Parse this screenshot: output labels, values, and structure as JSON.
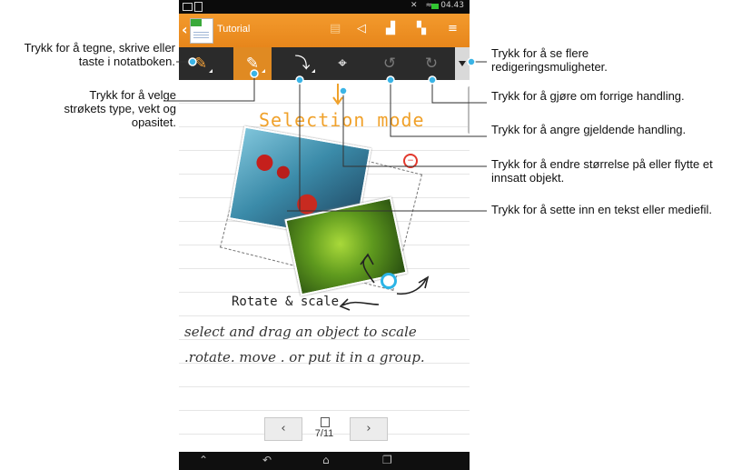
{
  "callouts": {
    "draw_mode": "Trykk for å tegne, skrive eller taste i notatboken.",
    "stroke_settings": "Trykk for å velge strøkets type, vekt og opasitet.",
    "more_options": "Trykk for å se flere redigeringsmuligheter.",
    "redo": "Trykk for å gjøre om forrige handling.",
    "undo": "Trykk for å angre gjeldende handling.",
    "selection": "Trykk for å endre størrelse på eller flytte et innsatt objekt.",
    "insert": "Trykk for å sette inn en tekst eller mediefil."
  },
  "statusbar": {
    "time": "04.43"
  },
  "actionbar": {
    "back": "‹",
    "title": "Tutorial"
  },
  "toolbar": {
    "draw": "✎",
    "pen": "✎",
    "insert": "⤵",
    "selection": "⌖",
    "undo": "↺",
    "redo": "↻"
  },
  "page": {
    "selection_mode": "Selection mode",
    "rotate_scale": "Rotate & scale",
    "hw_line1": "select and drag an object to scale",
    "hw_line2": ".rotate. move . or put it in a group."
  },
  "pager": {
    "prev": "‹",
    "next": "›",
    "count": "7/11"
  },
  "colors": {
    "accent": "#e08a22",
    "toolbar_bg": "#2b2b2b",
    "handwriting_orange": "#f0a12a",
    "cyan_handle": "#2cb4e6"
  },
  "icons": [
    "back-icon",
    "note-icon",
    "share-icon",
    "add-page-icon",
    "delete-page-icon",
    "menu-icon",
    "pen-icon",
    "insert-icon",
    "selection-icon",
    "undo-icon",
    "redo-icon",
    "overflow-icon",
    "home-icon",
    "back-nav-icon",
    "recent-apps-icon"
  ]
}
